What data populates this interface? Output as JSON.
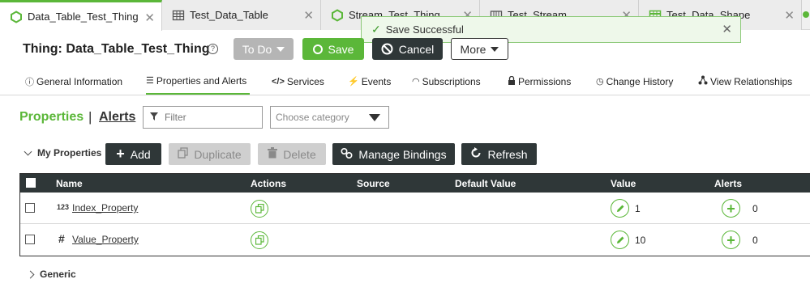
{
  "tabs": [
    {
      "label": "Data_Table_Test_Thing",
      "icon": "thing-hexagon-icon",
      "active": true
    },
    {
      "label": "Test_Data_Table",
      "icon": "data-table-icon",
      "active": false
    },
    {
      "label": "Stream_Test_Thing",
      "icon": "thing-hexagon-icon",
      "active": false
    },
    {
      "label": "Test_Stream",
      "icon": "stream-icon",
      "active": false
    },
    {
      "label": "Test_Data_Shape",
      "icon": "data-shape-icon",
      "active": false
    }
  ],
  "toast": {
    "message": "Save Successful"
  },
  "header": {
    "title": "Thing: Data_Table_Test_Thing",
    "todo_label": "To Do",
    "save_label": "Save",
    "cancel_label": "Cancel",
    "more_label": "More"
  },
  "subnav": [
    {
      "label": "General Information",
      "icon": "info-icon"
    },
    {
      "label": "Properties and Alerts",
      "icon": "list-icon",
      "active": true
    },
    {
      "label": "Services",
      "icon": "code-icon"
    },
    {
      "label": "Events",
      "icon": "lightning-icon"
    },
    {
      "label": "Subscriptions",
      "icon": "subscription-icon"
    },
    {
      "label": "Permissions",
      "icon": "lock-icon"
    },
    {
      "label": "Change History",
      "icon": "clock-icon"
    },
    {
      "label": "View Relationships",
      "icon": "relationships-icon"
    }
  ],
  "section": {
    "properties_label": "Properties",
    "separator": "|",
    "alerts_label": "Alerts",
    "filter_placeholder": "Filter",
    "category_placeholder": "Choose category"
  },
  "toolbar": {
    "group_label": "My Properties",
    "add_label": "Add",
    "duplicate_label": "Duplicate",
    "delete_label": "Delete",
    "manage_bindings_label": "Manage Bindings",
    "refresh_label": "Refresh"
  },
  "table": {
    "columns": [
      "Name",
      "Actions",
      "Source",
      "Default Value",
      "Value",
      "Alerts"
    ],
    "rows": [
      {
        "type": "123",
        "name": "Index_Property",
        "value": "1",
        "alerts": "0"
      },
      {
        "type": "#",
        "name": "Value_Property",
        "value": "10",
        "alerts": "0"
      }
    ]
  },
  "generic_group": {
    "label": "Generic"
  },
  "colors": {
    "accent": "#5bb739",
    "dark": "#2f3738",
    "disabled": "#cfcfcf"
  }
}
